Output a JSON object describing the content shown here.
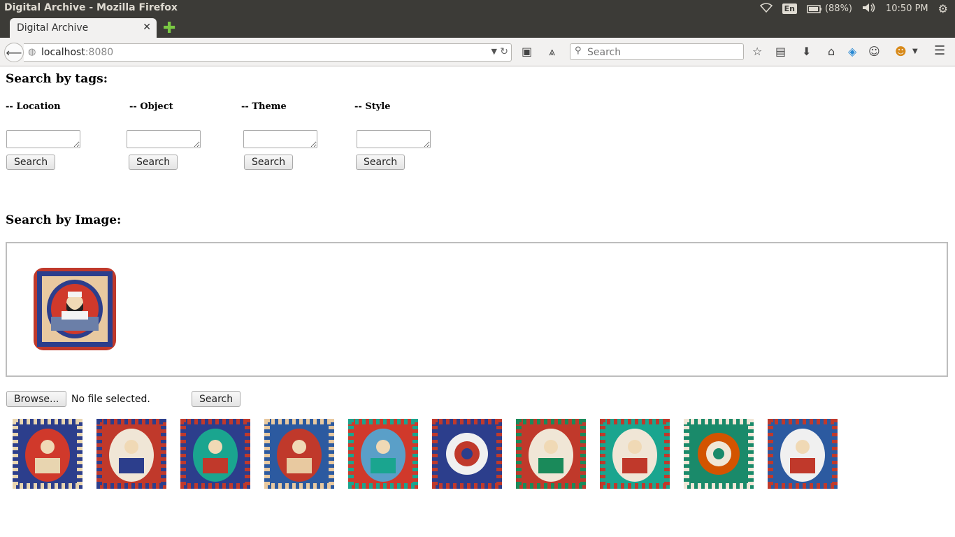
{
  "os": {
    "window_title": "Digital Archive - Mozilla Firefox",
    "keyboard": "En",
    "battery": "(88%)",
    "time": "10:50 PM"
  },
  "browser": {
    "tab_title": "Digital Archive",
    "url_host": "localhost",
    "url_port": ":8080",
    "search_placeholder": "Search"
  },
  "page": {
    "tags_heading": "Search by tags:",
    "tag_fields": [
      {
        "label": "-- Location",
        "button": "Search"
      },
      {
        "label": "-- Object",
        "button": "Search"
      },
      {
        "label": "-- Theme",
        "button": "Search"
      },
      {
        "label": "-- Style",
        "button": "Search"
      }
    ],
    "image_heading": "Search by Image:",
    "browse_label": "Browse...",
    "file_status": "No file selected.",
    "image_search_label": "Search",
    "results": [
      {
        "icon": "portrait-red-oval",
        "colors": [
          "#2c3e8c",
          "#d0392b",
          "#e8d5b0"
        ]
      },
      {
        "icon": "portrait-stripes",
        "colors": [
          "#c0392b",
          "#f0e6d6",
          "#2c3e8c"
        ]
      },
      {
        "icon": "portrait-green",
        "colors": [
          "#2c3e8c",
          "#1aa58f",
          "#c0392b"
        ]
      },
      {
        "icon": "figure-blue-red",
        "colors": [
          "#2c5aa0",
          "#c0392b",
          "#e8c9a0"
        ]
      },
      {
        "icon": "portrait-teal",
        "colors": [
          "#d0392b",
          "#5a9fc8",
          "#1aa58f"
        ]
      },
      {
        "icon": "floral-pattern",
        "colors": [
          "#2c3e8c",
          "#f0f0f0",
          "#c0392b"
        ]
      },
      {
        "icon": "portrait-green-frame",
        "colors": [
          "#c0392b",
          "#f0e6d6",
          "#1a8a5a"
        ]
      },
      {
        "icon": "figures-teal",
        "colors": [
          "#1aa58f",
          "#f0e6d6",
          "#c0392b"
        ]
      },
      {
        "icon": "floral-green",
        "colors": [
          "#1a8a6a",
          "#d35400",
          "#f0e6d6"
        ]
      },
      {
        "icon": "figure-white",
        "colors": [
          "#2c5aa0",
          "#f0f0f0",
          "#c0392b"
        ]
      }
    ]
  }
}
